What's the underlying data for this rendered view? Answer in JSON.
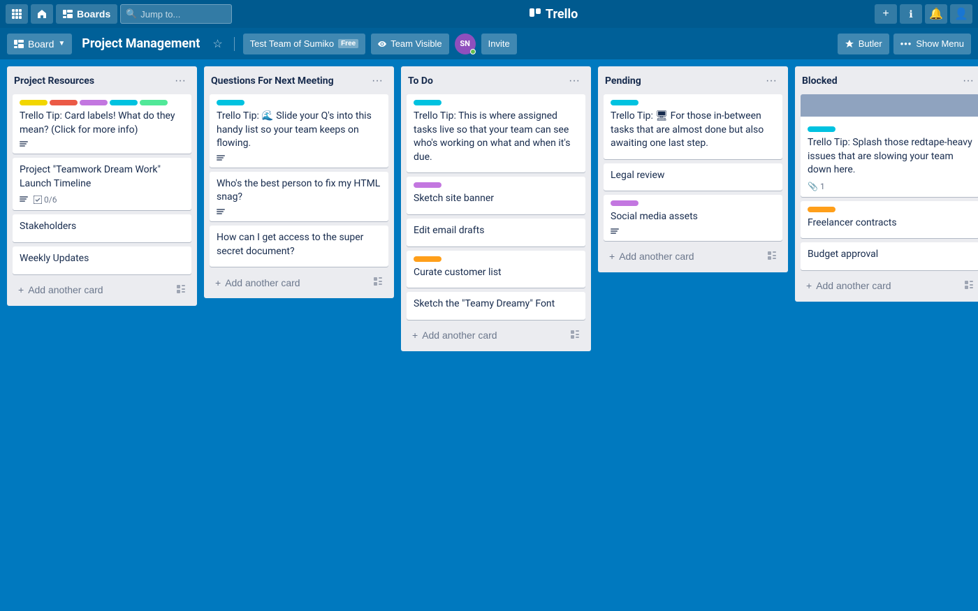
{
  "topnav": {
    "apps_label": "⊞",
    "home_label": "⌂",
    "boards_label": "Boards",
    "search_placeholder": "Jump to...",
    "logo": "Trello",
    "add_label": "+",
    "info_label": "ℹ",
    "bell_label": "🔔",
    "user_label": "👤"
  },
  "boardnav": {
    "board_label": "Board",
    "title": "Project Management",
    "team_label": "Test Team of Sumiko",
    "team_free": "Free",
    "visibility_label": "Team Visible",
    "avatar_initials": "SN",
    "invite_label": "Invite",
    "butler_label": "Butler",
    "show_menu_label": "Show Menu"
  },
  "lists": [
    {
      "id": "project-resources",
      "title": "Project Resources",
      "cards": [
        {
          "id": "pr-1",
          "labels": [
            "yellow",
            "red",
            "purple",
            "teal",
            "lime"
          ],
          "text": "Trello Tip: Card labels! What do they mean? (Click for more info)",
          "has_desc": true,
          "has_checklist": false,
          "checklist": null
        },
        {
          "id": "pr-2",
          "labels": [],
          "text": "Project \"Teamwork Dream Work\" Launch Timeline",
          "has_desc": true,
          "has_checklist": true,
          "checklist": "0/6"
        },
        {
          "id": "pr-3",
          "labels": [],
          "text": "Stakeholders",
          "has_desc": false,
          "has_checklist": false,
          "checklist": null
        },
        {
          "id": "pr-4",
          "labels": [],
          "text": "Weekly Updates",
          "has_desc": false,
          "has_checklist": false,
          "checklist": null
        }
      ],
      "add_card_label": "Add another card"
    },
    {
      "id": "questions-next-meeting",
      "title": "Questions For Next Meeting",
      "cards": [
        {
          "id": "qn-1",
          "labels": [
            "teal"
          ],
          "text": "Trello Tip: 🌊 Slide your Q's into this handy list so your team keeps on flowing.",
          "has_desc": true,
          "has_checklist": false,
          "checklist": null
        },
        {
          "id": "qn-2",
          "labels": [],
          "text": "Who's the best person to fix my HTML snag?",
          "has_desc": true,
          "has_checklist": false,
          "checklist": null
        },
        {
          "id": "qn-3",
          "labels": [],
          "text": "How can I get access to the super secret document?",
          "has_desc": false,
          "has_checklist": false,
          "checklist": null
        }
      ],
      "add_card_label": "Add another card"
    },
    {
      "id": "to-do",
      "title": "To Do",
      "cards": [
        {
          "id": "td-1",
          "labels": [
            "teal"
          ],
          "text": "Trello Tip: This is where assigned tasks live so that your team can see who's working on what and when it's due.",
          "has_desc": false,
          "has_checklist": false,
          "checklist": null
        },
        {
          "id": "td-2",
          "labels": [
            "purple"
          ],
          "text": "Sketch site banner",
          "has_desc": false,
          "has_checklist": false,
          "checklist": null
        },
        {
          "id": "td-3",
          "labels": [],
          "text": "Edit email drafts",
          "has_desc": false,
          "has_checklist": false,
          "checklist": null
        },
        {
          "id": "td-4",
          "labels": [
            "orange"
          ],
          "text": "Curate customer list",
          "has_desc": false,
          "has_checklist": false,
          "checklist": null
        },
        {
          "id": "td-5",
          "labels": [],
          "text": "Sketch the \"Teamy Dreamy\" Font",
          "has_desc": false,
          "has_checklist": false,
          "checklist": null
        }
      ],
      "add_card_label": "Add another card"
    },
    {
      "id": "pending",
      "title": "Pending",
      "cards": [
        {
          "id": "pe-1",
          "labels": [
            "teal"
          ],
          "text": "Trello Tip: 🖥 For those in-between tasks that are almost done but also awaiting one last step.",
          "has_desc": false,
          "has_checklist": false,
          "checklist": null
        },
        {
          "id": "pe-2",
          "labels": [],
          "text": "Legal review",
          "has_desc": false,
          "has_checklist": false,
          "checklist": null
        },
        {
          "id": "pe-3",
          "labels": [
            "purple"
          ],
          "text": "Social media assets",
          "has_desc": true,
          "has_checklist": false,
          "checklist": null
        }
      ],
      "add_card_label": "Add another card"
    },
    {
      "id": "blocked",
      "title": "Blocked",
      "cards": [
        {
          "id": "bl-1",
          "labels": [
            "blue-gray-top"
          ],
          "text": "Trello Tip: Splash those redtape-heavy issues that are slowing your team down here.",
          "has_attachment": true,
          "attachment_count": "1",
          "has_desc": false,
          "has_checklist": false,
          "checklist": null,
          "top_bar": true
        },
        {
          "id": "bl-2",
          "labels": [
            "orange"
          ],
          "text": "Freelancer contracts",
          "has_desc": false,
          "has_checklist": false,
          "checklist": null
        },
        {
          "id": "bl-3",
          "labels": [],
          "text": "Budget approval",
          "has_desc": false,
          "has_checklist": false,
          "checklist": null
        }
      ],
      "add_card_label": "Add another card"
    }
  ],
  "label_colors": {
    "yellow": "#f2d600",
    "red": "#eb5a46",
    "purple": "#c377e0",
    "teal": "#00c2e0",
    "lime": "#51e898",
    "orange": "#ff9f1a",
    "blue-gray": "#8fa3bf"
  }
}
